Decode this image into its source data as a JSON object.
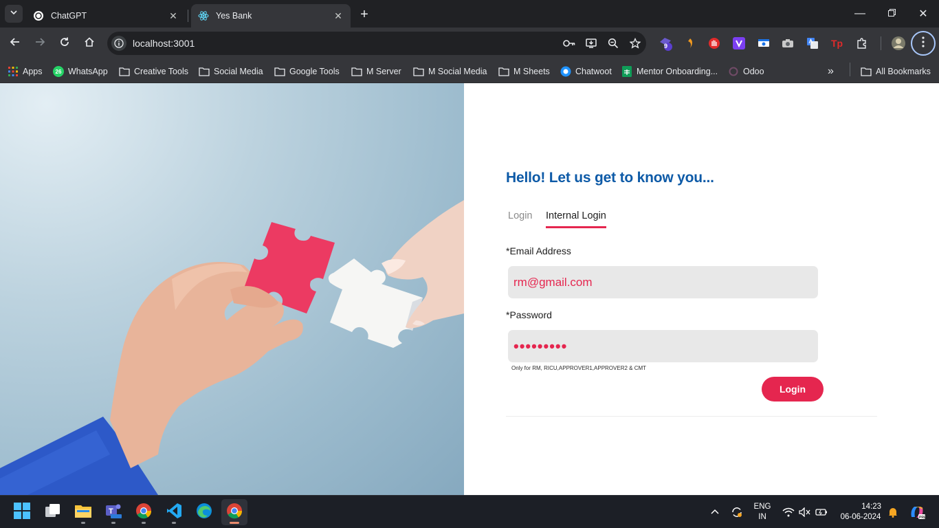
{
  "browser": {
    "tabs": [
      {
        "title": "ChatGPT",
        "active": false,
        "icon": "chatgpt-icon"
      },
      {
        "title": "Yes Bank",
        "active": true,
        "icon": "react-icon"
      }
    ],
    "url": "localhost:3001",
    "extension_badge": "9",
    "bookmarks": [
      {
        "label": "Apps",
        "icon": "apps-grid-icon"
      },
      {
        "label": "WhatsApp",
        "icon": "whatsapp-icon",
        "badge": "26"
      },
      {
        "label": "Creative Tools",
        "icon": "folder-icon"
      },
      {
        "label": "Social Media",
        "icon": "folder-icon"
      },
      {
        "label": "Google Tools",
        "icon": "folder-icon"
      },
      {
        "label": "M Server",
        "icon": "folder-icon"
      },
      {
        "label": "M Social Media",
        "icon": "folder-icon"
      },
      {
        "label": "M Sheets",
        "icon": "folder-icon"
      },
      {
        "label": "Chatwoot",
        "icon": "chatwoot-icon"
      },
      {
        "label": "Mentor Onboarding...",
        "icon": "sheets-icon"
      },
      {
        "label": "Odoo",
        "icon": "odoo-icon"
      }
    ],
    "all_bookmarks": "All Bookmarks"
  },
  "page": {
    "greeting": "Hello! Let us get to know you...",
    "tabs": {
      "login": "Login",
      "internal": "Internal Login"
    },
    "email": {
      "label": "*Email Address",
      "value": "rm@gmail.com"
    },
    "password": {
      "label": "*Password",
      "masked": "•••••••••"
    },
    "hint": "Only for RM, RICU,APPROVER1,APPROVER2 & CMT",
    "submit": "Login"
  },
  "taskbar": {
    "language": {
      "line1": "ENG",
      "line2": "IN"
    },
    "time": "14:23",
    "date": "06-06-2024"
  },
  "colors": {
    "accent": "#e5264f",
    "heading": "#0d5aa7",
    "input_bg": "#e8e8e8",
    "browser_dark": "#202124",
    "browser_toolbar": "#35363a"
  }
}
